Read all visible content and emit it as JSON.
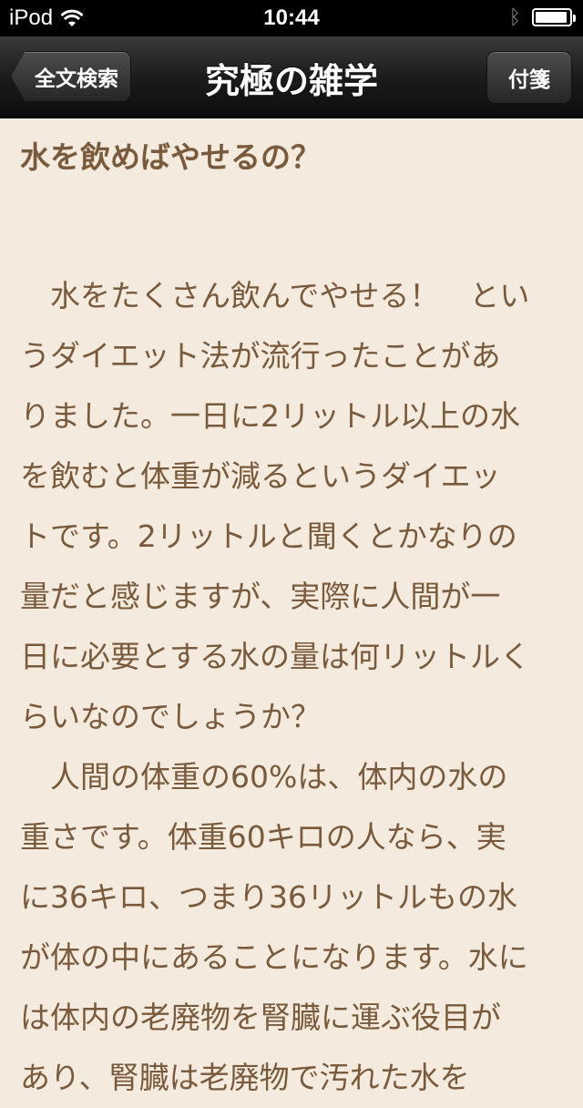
{
  "status_bar": {
    "device": "iPod",
    "time": "10:44",
    "battery_level": 0.95
  },
  "nav": {
    "title": "究極の雑学",
    "back_label": "全文検索",
    "right_label": "付箋"
  },
  "article": {
    "heading": "水を飲めばやせるの？",
    "paragraphs": [
      "水をたくさん飲んでやせる！　というダイエット法が流行ったことがありました。一日に2リットル以上の水を飲むと体重が減るというダイエットです。2リットルと聞くとかなりの量だと感じますが、実際に人間が一日に必要とする水の量は何リットルくらいなのでしょうか？",
      "人間の体重の60%は、体内の水の重さです。体重60キロの人なら、実に36キロ、つまり36リットルもの水が体の中にあることになります。水には体内の老廃物を腎臓に運ぶ役目があり、腎臓は老廃物で汚れた水を"
    ]
  },
  "colors": {
    "page_background": "#f4ebde",
    "text": "#7a5a3c",
    "nav_background": "#1c1c1c"
  }
}
